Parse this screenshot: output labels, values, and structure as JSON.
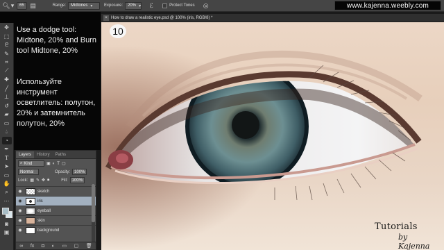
{
  "options_bar": {
    "brush_size": "65",
    "range_label": "Range:",
    "range_value": "Midtones",
    "exposure_label": "Exposure:",
    "exposure_value": "20%",
    "protect_tones_label": "Protect Tones",
    "website": "www.kajenna.weebly.com"
  },
  "instructions": {
    "english": "Use a dodge tool: Midtone, 20% and Burn tool Midtone, 20%",
    "russian": "Используйте инструмент осветлитель: полутон, 20% и затемнитель полутон, 20%"
  },
  "document": {
    "tab_title": "How to draw a realistic eye.psd @ 100% (iris, RGB/8) *",
    "step_number": "10"
  },
  "layers_panel": {
    "tabs": [
      "Layers",
      "History",
      "Paths"
    ],
    "kind_label": "Kind",
    "blend_mode": "Normal",
    "opacity_label": "Opacity:",
    "opacity_value": "100%",
    "lock_label": "Lock:",
    "fill_label": "Fill:",
    "fill_value": "100%",
    "layers": [
      {
        "name": "sketch",
        "selected": false
      },
      {
        "name": "iris",
        "selected": true
      },
      {
        "name": "eyeball",
        "selected": false
      },
      {
        "name": "skin",
        "selected": false
      },
      {
        "name": "background",
        "selected": false
      }
    ]
  },
  "branding": {
    "line1": "Tutorials",
    "line2": "by Kajenna"
  },
  "colors": {
    "foreground": "#a7bdc6",
    "background": "#d9e6ec",
    "selected_layer": "#a2b0bf"
  }
}
